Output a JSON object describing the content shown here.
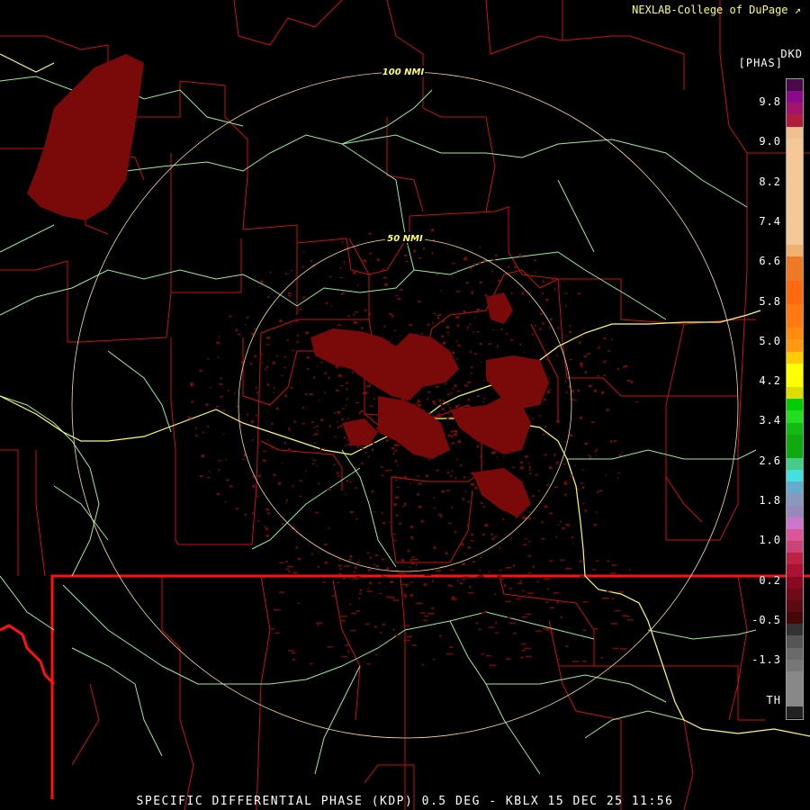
{
  "credit": "NEXLAB-College of DuPage",
  "credit_icon": "cursor-icon",
  "product_code": "DKD",
  "product_unit": "[PHAS]",
  "footer": "SPECIFIC DIFFERENTIAL PHASE (KDP) 0.5 DEG - KBLX 15 DEC 25 11:56",
  "range_rings": [
    {
      "label": "100 NMI",
      "range_nmi": 100
    },
    {
      "label": "50 NMI",
      "range_nmi": 50
    }
  ],
  "colorbar_ticks": [
    "9.8",
    "9.0",
    "8.2",
    "7.4",
    "6.6",
    "5.8",
    "5.0",
    "4.2",
    "3.4",
    "2.6",
    "1.8",
    "1.0",
    "0.2",
    "-0.5",
    "-1.3",
    "TH"
  ],
  "colors": {
    "county_lines": "#cc1111",
    "state_line": "#ff1111",
    "highways_major": "#ffff66",
    "highways_minor": "#99ee99",
    "range_rings": "#ffdd99",
    "echo": "#7a0a0a",
    "credit": "#ffff66"
  },
  "colorbar_colors": [
    "#4a0a4a",
    "#8a0a8a",
    "#a0146e",
    "#b01e3c",
    "#f0c090",
    "#f5c898",
    "#f5c898",
    "#f5c898",
    "#f5c898",
    "#f5c898",
    "#f5c898",
    "#f5c898",
    "#f5c898",
    "#f5c898",
    "#f0b070",
    "#ee7a28",
    "#ee7a28",
    "#ff6a10",
    "#ff6a10",
    "#ff7a10",
    "#ff7a10",
    "#ff8a10",
    "#ff9a10",
    "#ffcc00",
    "#ffff00",
    "#ffff00",
    "#dddd00",
    "#00cc00",
    "#22dd22",
    "#11bb11",
    "#10aa10",
    "#10aa10",
    "#44cc88",
    "#44e0e0",
    "#66aacc",
    "#8899bb",
    "#9988bb",
    "#cc77cc",
    "#dd5599",
    "#cc4477",
    "#bb2244",
    "#aa1133",
    "#880a22",
    "#700a18",
    "#5a0a10",
    "#440808",
    "#333333",
    "#555555",
    "#6a6a6a",
    "#777777",
    "#888888",
    "#888888",
    "#888888",
    "#222222"
  ]
}
